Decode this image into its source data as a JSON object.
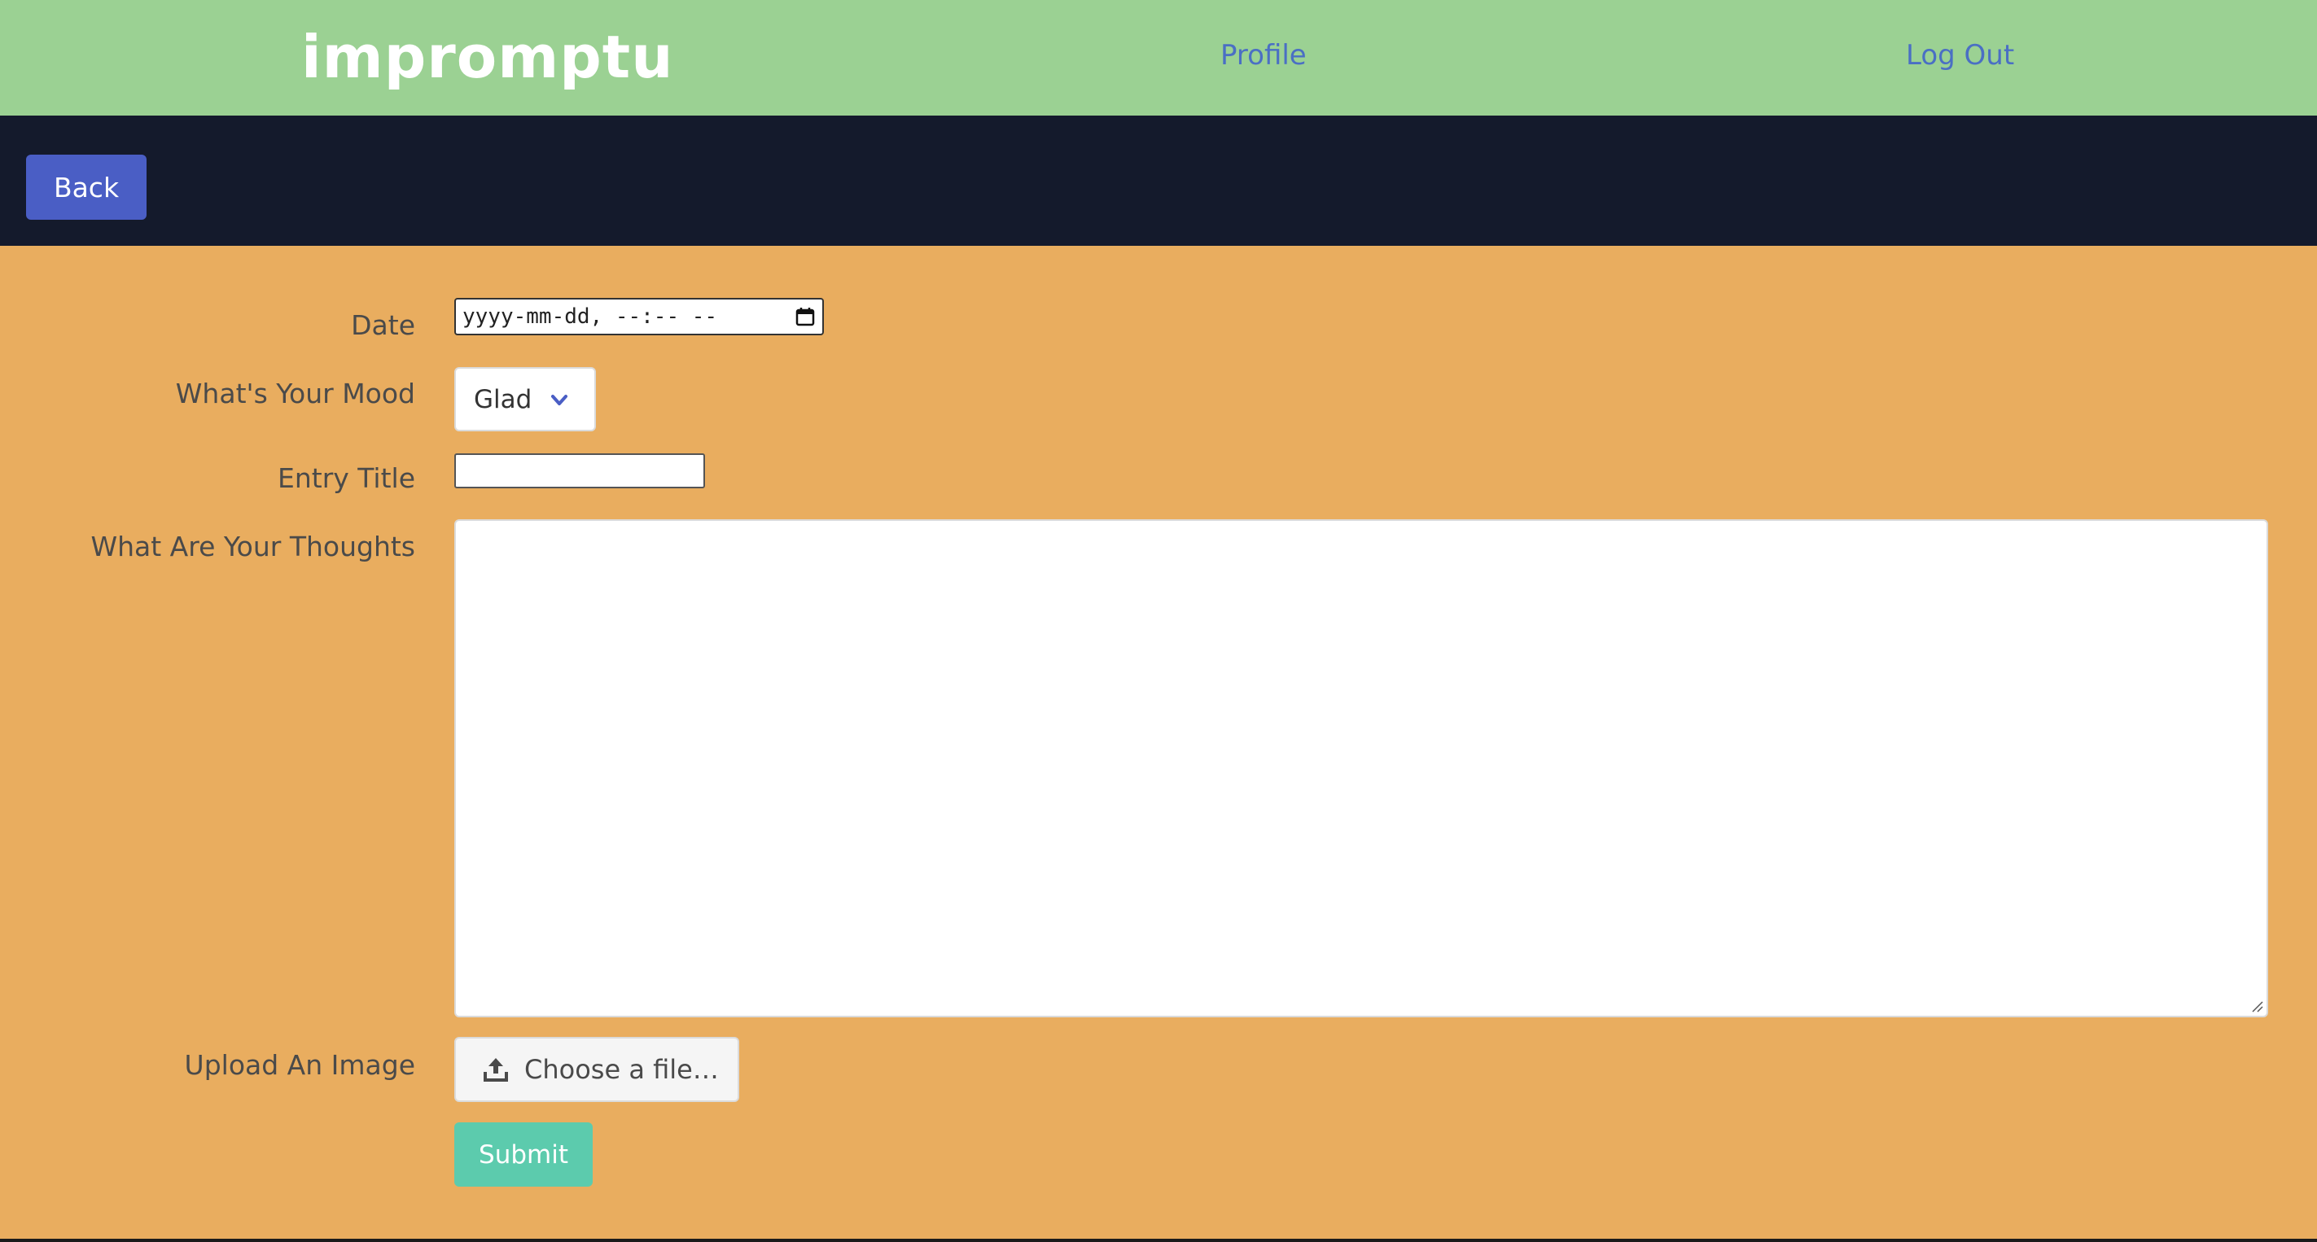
{
  "navbar": {
    "brand": "impromptu",
    "links": {
      "profile": "Profile",
      "logout": "Log Out"
    },
    "colors": {
      "background": "#9bd193",
      "link": "#4a6fc4"
    }
  },
  "toolbar": {
    "back_label": "Back",
    "colors": {
      "background": "#141a2c",
      "button": "#4a5ec5"
    }
  },
  "form": {
    "background_color": "#e9ad5f",
    "date": {
      "label": "Date",
      "value": "yyyy-mm-dd, --:-- --",
      "icon": "calendar-icon"
    },
    "mood": {
      "label": "What's Your Mood",
      "selected": "Glad",
      "icon": "chevron-down-icon"
    },
    "entry_title": {
      "label": "Entry Title",
      "value": ""
    },
    "thoughts": {
      "label": "What Are Your Thoughts",
      "value": ""
    },
    "upload": {
      "label": "Upload An Image",
      "button_label": "Choose a file…",
      "icon": "upload-icon"
    },
    "submit_label": "Submit",
    "submit_color": "#5ccbad"
  }
}
